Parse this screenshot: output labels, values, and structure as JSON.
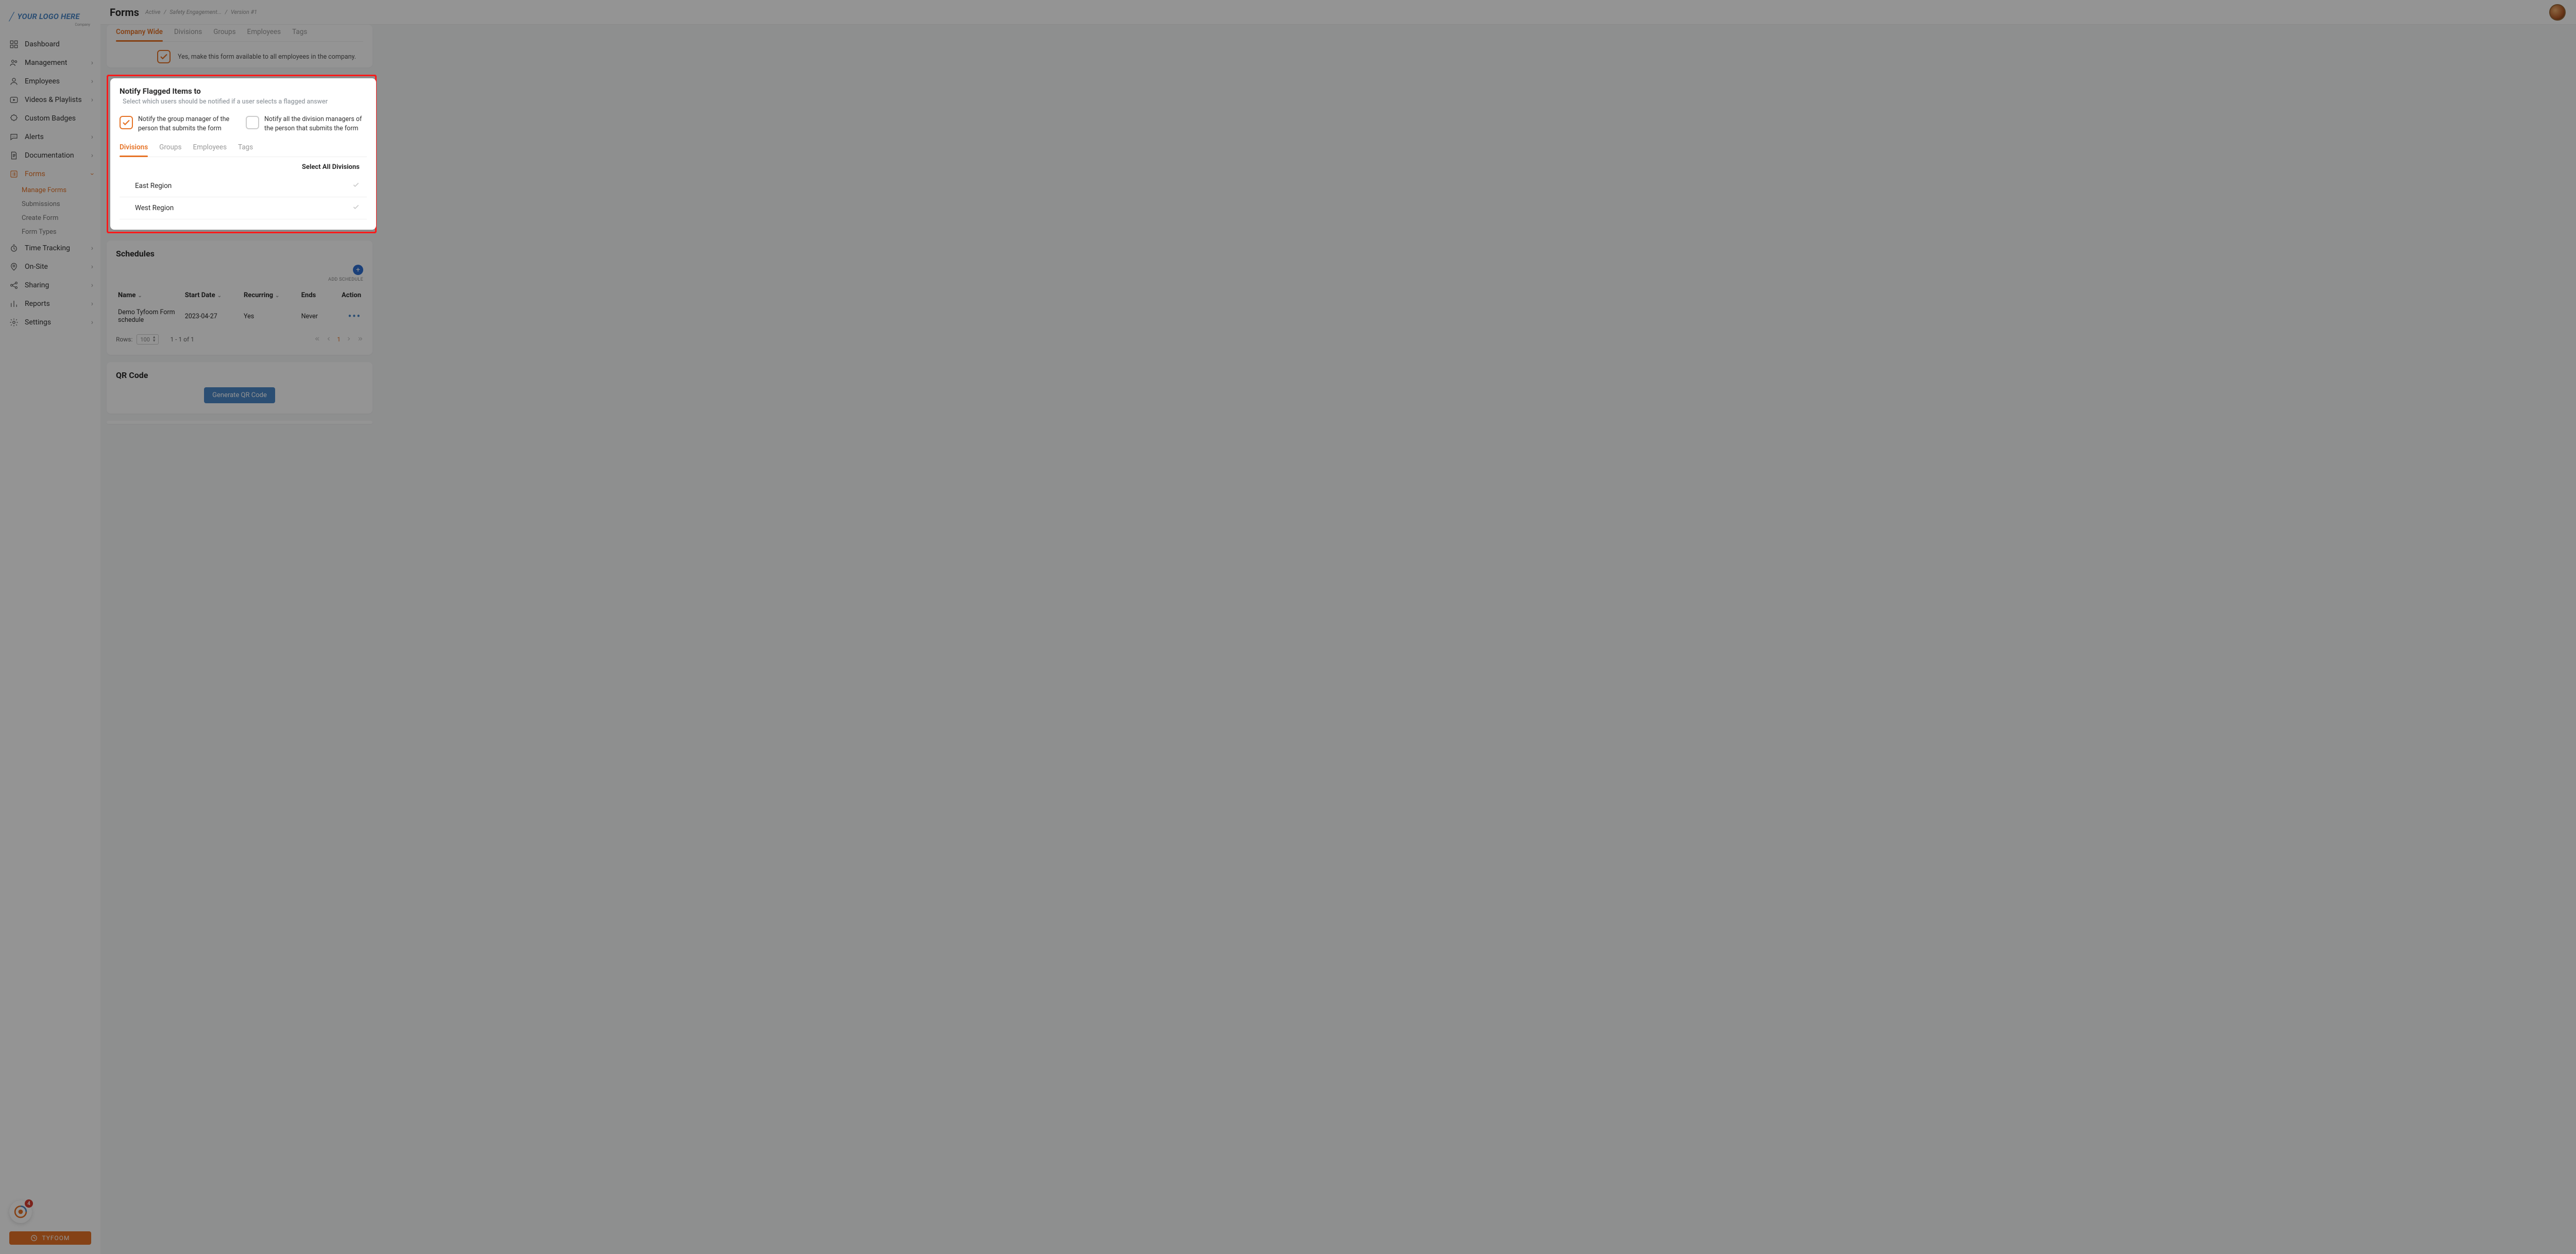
{
  "logo": {
    "main": "YOUR LOGO HERE",
    "sub": "Company"
  },
  "nav": {
    "dashboard": "Dashboard",
    "management": "Management",
    "employees": "Employees",
    "videos": "Videos & Playlists",
    "badges": "Custom Badges",
    "alerts": "Alerts",
    "documentation": "Documentation",
    "forms": "Forms",
    "forms_sub": {
      "manage": "Manage Forms",
      "submissions": "Submissions",
      "create": "Create Form",
      "types": "Form Types"
    },
    "time": "Time Tracking",
    "onsite": "On-Site",
    "sharing": "Sharing",
    "reports": "Reports",
    "settings": "Settings"
  },
  "help_badge": "4",
  "tyfoom_btn": "TYFOOM",
  "header": {
    "title": "Forms",
    "crumb1": "Active",
    "crumb2": "Safety Engagement...",
    "crumb3": "Version #1"
  },
  "avail": {
    "tabs": {
      "company": "Company Wide",
      "divisions": "Divisions",
      "groups": "Groups",
      "employees": "Employees",
      "tags": "Tags"
    },
    "check_text": "Yes, make this form available to all employees in the company."
  },
  "notify": {
    "title": "Notify Flagged Items to",
    "subtitle": "Select which users should be notified if a user selects a flagged answer",
    "opt1": "Notify the group manager of the person that submits the form",
    "opt2": "Notify all the division managers of the person that submits the form",
    "tabs": {
      "divisions": "Divisions",
      "groups": "Groups",
      "employees": "Employees",
      "tags": "Tags"
    },
    "select_all": "Select All Divisions",
    "rows": [
      {
        "name": "East Region"
      },
      {
        "name": "West Region"
      }
    ]
  },
  "sched": {
    "title": "Schedules",
    "add_label": "ADD SCHEDULE",
    "cols": {
      "name": "Name",
      "start": "Start Date",
      "recurring": "Recurring",
      "ends": "Ends",
      "action": "Action"
    },
    "row": {
      "name": "Demo Tyfoom Form schedule",
      "start": "2023-04-27",
      "recurring": "Yes",
      "ends": "Never"
    },
    "pager": {
      "rows_label": "Rows:",
      "rows_val": "100",
      "range": "1 - 1 of 1",
      "current": "1"
    }
  },
  "qr": {
    "title": "QR Code",
    "button": "Generate QR Code"
  }
}
